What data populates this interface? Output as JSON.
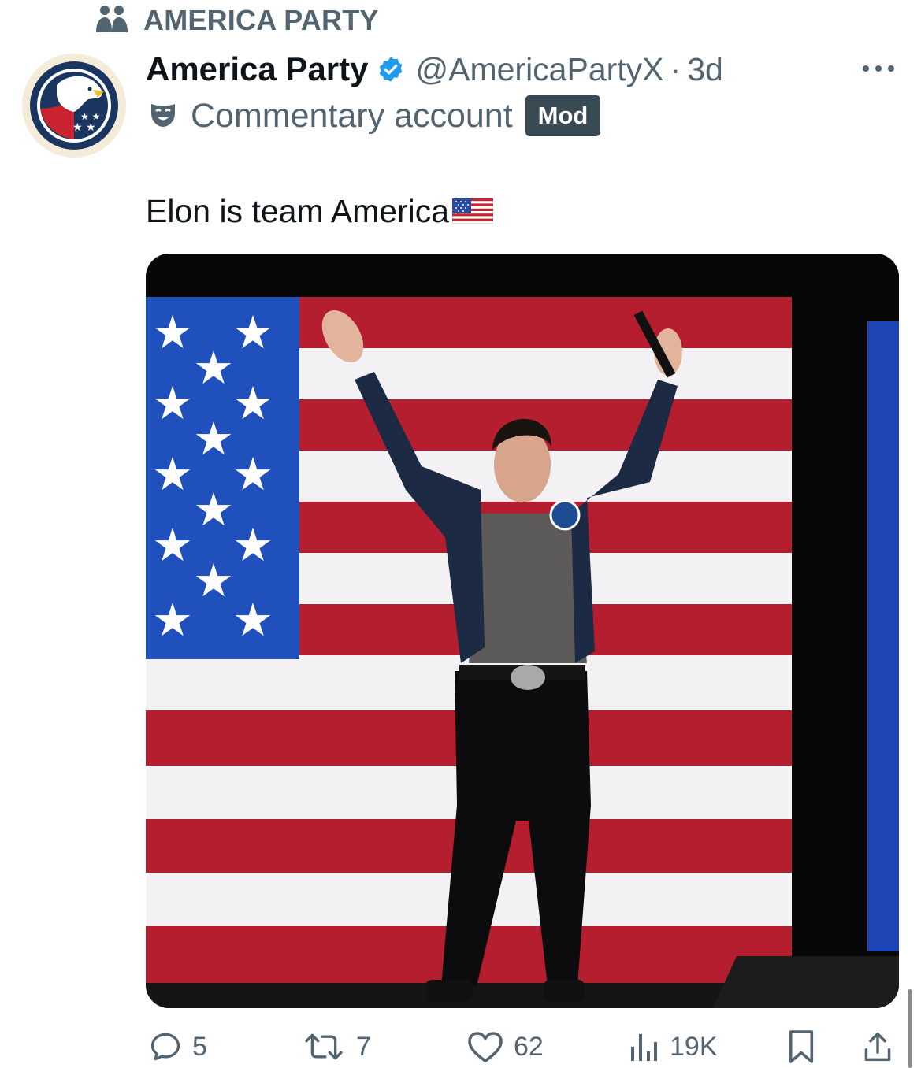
{
  "community": {
    "icon": "community-icon",
    "label": "AMERICA PARTY"
  },
  "post": {
    "avatar_icon": "america-party-eagle-logo",
    "display_name": "America Party",
    "verified_icon": "verified-badge-icon",
    "handle": "@AmericaPartyX",
    "separator": "·",
    "time": "3d",
    "label_icon": "theater-mask-icon",
    "account_label": "Commentary account",
    "badge": "Mod",
    "text": "Elon is team America",
    "text_emoji": "us-flag-emoji",
    "media": {
      "description_icon": "photo",
      "alt": "Man with raised arms on stage in front of a large American flag",
      "content_icon": "stage-photo"
    }
  },
  "actions": {
    "reply_count": "5",
    "repost_count": "7",
    "like_count": "62",
    "views_count": "19K"
  },
  "colors": {
    "secondary_text": "#536471",
    "verified_blue": "#1d9bf0",
    "badge_bg": "#3a4a55",
    "flag_red": "#b41f2e",
    "flag_blue": "#1f4fb8"
  }
}
